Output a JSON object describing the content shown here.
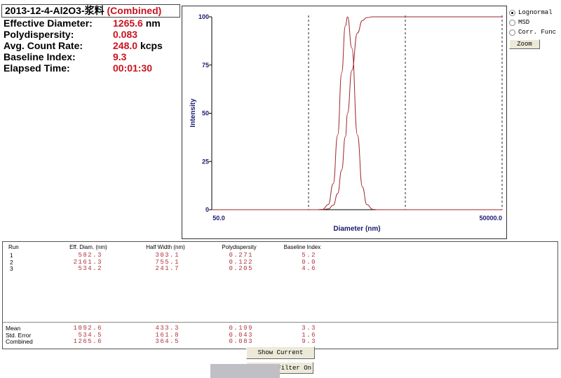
{
  "header": {
    "sample": "2013-12-4-Al2O3-浆料",
    "tag": "(Combined)"
  },
  "summary": [
    {
      "label": "Effective Diameter:",
      "value": "1265.6",
      "unit": "nm"
    },
    {
      "label": "Polydispersity:",
      "value": "0.083",
      "unit": ""
    },
    {
      "label": "Avg. Count Rate:",
      "value": "248.0",
      "unit": "kcps"
    },
    {
      "label": "Baseline Index:",
      "value": "9.3",
      "unit": ""
    },
    {
      "label": "Elapsed Time:",
      "value": "00:01:30",
      "unit": ""
    }
  ],
  "options": {
    "items": [
      {
        "label": "Lognormal",
        "selected": true
      },
      {
        "label": "MSD",
        "selected": false
      },
      {
        "label": "Corr. Func",
        "selected": false
      }
    ],
    "zoom_label": "Zoom"
  },
  "chart_data": {
    "type": "line",
    "x_scale": "log",
    "xlabel": "Diameter (nm)",
    "ylabel": "Intensity",
    "xlim": [
      50,
      50000
    ],
    "ylim": [
      0,
      100
    ],
    "x_tick_labels": [
      "50.0",
      "50000.0"
    ],
    "y_tick_labels": [
      "0",
      "25",
      "50",
      "75",
      "100"
    ],
    "vertical_markers": [
      500,
      5000,
      50000
    ],
    "colors": {
      "curve": "#a0262c",
      "axis_text": "#1a1a6e"
    },
    "series": [
      {
        "x": [
          50,
          600,
          700,
          800,
          900,
          1000,
          1100,
          1200,
          1265.6,
          1400,
          1600,
          1800,
          2000,
          2300,
          2600,
          50000
        ],
        "values": [
          0,
          0,
          0.2,
          2.7,
          13.5,
          38.7,
          71,
          95.3,
          100,
          83.8,
          38.7,
          11.8,
          2.7,
          0.2,
          0,
          0
        ]
      },
      {
        "x": [
          50,
          600,
          700,
          800,
          900,
          1000,
          1100,
          1200,
          1265.6,
          1400,
          1600,
          1800,
          2000,
          2300,
          5000,
          50000
        ],
        "values": [
          0,
          0,
          0.1,
          0.4,
          2.3,
          8.4,
          20.6,
          37.8,
          50,
          72.2,
          91.6,
          98.1,
          99.6,
          100,
          100,
          100
        ]
      }
    ]
  },
  "table": {
    "headers": [
      "Run",
      "Eff. Diam. (nm)",
      "Half Width (nm)",
      "Polydispersity",
      "Baseline Index"
    ],
    "rows": [
      [
        "1",
        "582.3",
        "303.1",
        "0.271",
        "5.2"
      ],
      [
        "2",
        "2161.3",
        "755.1",
        "0.122",
        "0.0"
      ],
      [
        "3",
        "534.2",
        "241.7",
        "0.205",
        "4.6"
      ]
    ],
    "stats": [
      [
        "Mean",
        "1092.6",
        "433.3",
        "0.199",
        "3.3"
      ],
      [
        "Std. Error",
        "534.5",
        "161.8",
        "0.043",
        "1.6"
      ],
      [
        "Combined",
        "1265.6",
        "364.5",
        "0.083",
        "9.3"
      ]
    ]
  },
  "buttons": {
    "show_current": "Show Current",
    "filter_on": "Filter On"
  }
}
